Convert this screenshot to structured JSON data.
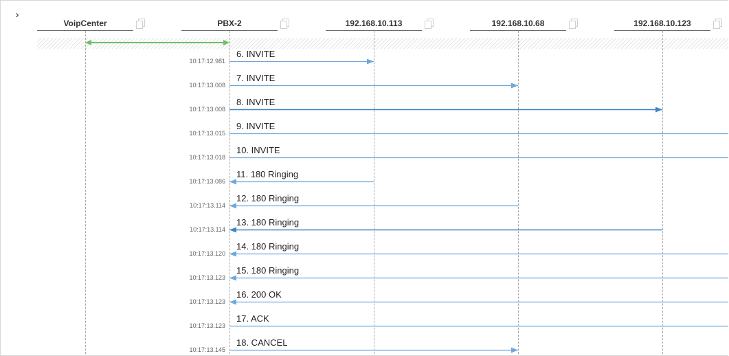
{
  "expand_icon": "chevron-right-icon",
  "colors": {
    "arrow": "#6fa8dc",
    "arrow_dark": "#3d85c6",
    "span": "#6abf69",
    "lifeline": "#a8a8a8"
  },
  "hosts": [
    {
      "id": "voipcenter",
      "label": "VoipCenter"
    },
    {
      "id": "pbx-2",
      "label": "PBX-2"
    },
    {
      "id": "host-113",
      "label": "192.168.10.113"
    },
    {
      "id": "host-68",
      "label": "192.168.10.68"
    },
    {
      "id": "host-123",
      "label": "192.168.10.123"
    }
  ],
  "span": {
    "from": 0,
    "to": 1
  },
  "messages": [
    {
      "label": "6. INVITE",
      "time": "10:17:12.981",
      "from": 1,
      "to": 2
    },
    {
      "label": "7. INVITE",
      "time": "10:17:13.008",
      "from": 1,
      "to": 3
    },
    {
      "label": "8. INVITE",
      "time": "10:17:13.008",
      "from": 1,
      "to": 4,
      "bold": true
    },
    {
      "label": "9. INVITE",
      "time": "10:17:13.015",
      "from": 1,
      "to": "offscreen"
    },
    {
      "label": "10. INVITE",
      "time": "10:17:13.018",
      "from": 1,
      "to": "offscreen"
    },
    {
      "label": "11. 180 Ringing",
      "time": "10:17:13.086",
      "from": 2,
      "to": 1
    },
    {
      "label": "12. 180 Ringing",
      "time": "10:17:13.114",
      "from": 3,
      "to": 1
    },
    {
      "label": "13. 180 Ringing",
      "time": "10:17:13.114",
      "from": 4,
      "to": 1,
      "bold": true
    },
    {
      "label": "14. 180 Ringing",
      "time": "10:17:13.120",
      "from": "offscreen",
      "to": 1
    },
    {
      "label": "15. 180 Ringing",
      "time": "10:17:13.123",
      "from": "offscreen",
      "to": 1
    },
    {
      "label": "16. 200 OK",
      "time": "10:17:13.123",
      "from": "offscreen",
      "to": 1
    },
    {
      "label": "17. ACK",
      "time": "10:17:13.123",
      "from": 1,
      "to": "offscreen"
    },
    {
      "label": "18. CANCEL",
      "time": "10:17:13.145",
      "from": 1,
      "to": 3
    }
  ]
}
